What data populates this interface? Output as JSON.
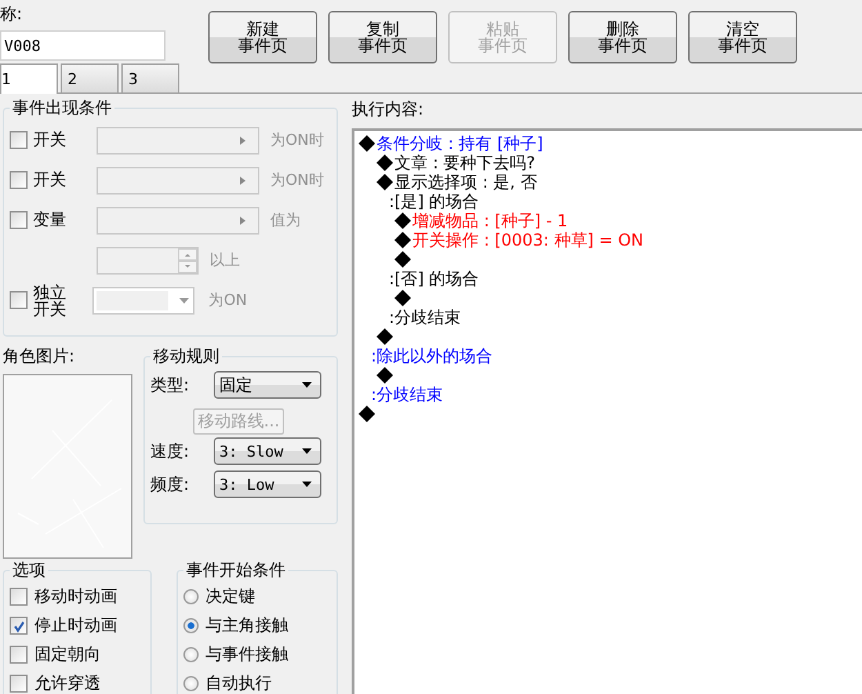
{
  "name_field": {
    "label": "称:",
    "value": "V008"
  },
  "buttons": [
    {
      "lines": [
        "新建",
        "事件页"
      ],
      "disabled": false
    },
    {
      "lines": [
        "复制",
        "事件页"
      ],
      "disabled": false
    },
    {
      "lines": [
        "粘贴",
        "事件页"
      ],
      "disabled": true
    },
    {
      "lines": [
        "删除",
        "事件页"
      ],
      "disabled": false
    },
    {
      "lines": [
        "清空",
        "事件页"
      ],
      "disabled": false
    }
  ],
  "tabs": [
    {
      "label": "1",
      "selected": true
    },
    {
      "label": "2",
      "selected": false
    },
    {
      "label": "3",
      "selected": false
    }
  ],
  "appear_conditions": {
    "title": "事件出现条件",
    "rows": [
      {
        "kind": "dropdown",
        "label": "开关",
        "checked": false,
        "suffix": "为ON时"
      },
      {
        "kind": "dropdown",
        "label": "开关",
        "checked": false,
        "suffix": "为ON时"
      },
      {
        "kind": "dropdown",
        "label": "变量",
        "checked": false,
        "suffix": "值为"
      },
      {
        "kind": "spin",
        "suffix": "以上"
      },
      {
        "kind": "combo",
        "label": "独立开关",
        "checked": false,
        "suffix": "为ON"
      }
    ]
  },
  "graphic": {
    "label": "角色图片:"
  },
  "movement": {
    "title": "移动规则",
    "type_label": "类型:",
    "type_value": "固定",
    "route_button": "移动路线...",
    "route_disabled": true,
    "speed_label": "速度:",
    "speed_value": "3: Slow",
    "freq_label": "频度:",
    "freq_value": "3: Low"
  },
  "options": {
    "title": "选项",
    "items": [
      {
        "label": "移动时动画",
        "checked": false
      },
      {
        "label": "停止时动画",
        "checked": true
      },
      {
        "label": "固定朝向",
        "checked": false
      },
      {
        "label": "允许穿透",
        "checked": false
      }
    ]
  },
  "trigger": {
    "title": "事件开始条件",
    "items": [
      {
        "label": "决定键",
        "selected": false
      },
      {
        "label": "与主角接触",
        "selected": true
      },
      {
        "label": "与事件接触",
        "selected": false
      },
      {
        "label": "自动执行",
        "selected": false
      }
    ]
  },
  "commands": {
    "label": "执行内容:",
    "lines": [
      {
        "kind": "command",
        "text": "条件分岐 : 持有 [种子]",
        "color": "#0000ff",
        "children": [
          {
            "kind": "command",
            "text": "文章 : 要种下去吗?",
            "color": "#000000"
          },
          {
            "kind": "command",
            "text": "显示选择项 : 是, 否",
            "color": "#000000",
            "children": [
              {
                "kind": "branch",
                "text": ":[是] 的场合",
                "color": "#000000",
                "children": [
                  {
                    "kind": "command",
                    "text": "增减物品 : [种子] - 1",
                    "color": "#ff0000"
                  },
                  {
                    "kind": "command",
                    "text": "开关操作 : [0003: 种草] = ON",
                    "color": "#ff0000"
                  },
                  {
                    "kind": "command",
                    "color": "#000000"
                  }
                ]
              },
              {
                "kind": "branch",
                "text": ":[否] 的场合",
                "color": "#000000",
                "children": [
                  {
                    "kind": "command",
                    "color": "#000000"
                  }
                ]
              },
              {
                "kind": "branch",
                "text": ":分歧结束",
                "color": "#000000"
              }
            ]
          },
          {
            "kind": "command",
            "color": "#000000"
          },
          {
            "kind": "branch",
            "text": ":除此以外的场合",
            "color": "#0000ff",
            "children": [
              {
                "kind": "command",
                "color": "#000000"
              }
            ]
          },
          {
            "kind": "branch",
            "text": ":分歧结束",
            "color": "#0000ff"
          }
        ]
      },
      {
        "kind": "command",
        "color": "#000000"
      }
    ]
  }
}
